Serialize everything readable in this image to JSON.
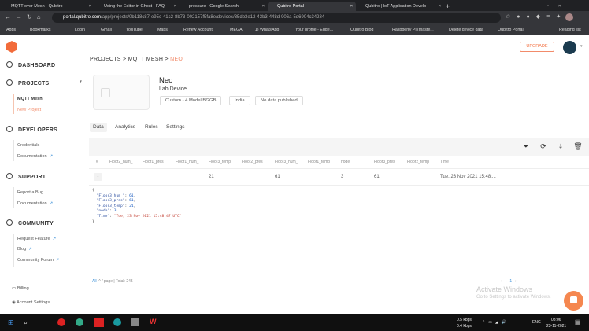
{
  "browser": {
    "tabs": [
      {
        "label": "MQTT over Mesh - Qubitro"
      },
      {
        "label": "Using the Editor in Ghost - FAQ"
      },
      {
        "label": "pressure - Google Search"
      },
      {
        "label": "Qubitro Portal"
      },
      {
        "label": "Qubitro | IoT Application Develo"
      }
    ],
    "url_host": "portal.qubitro.com",
    "url_path": "/app/projects/0b118c87-e95c-41c2-8b73-002157f5fa8e/devices/35db3e12-43b3-448d-906a-5d6904c34284",
    "bookmarks": [
      "Apps",
      "Bookmarks",
      "Login",
      "Gmail",
      "YouTube",
      "Maps",
      "Renew Account",
      "MEGA",
      "(1) WhatsApp",
      "Your profile - Edge...",
      "Qubitro Blog",
      "Raspberry Pi (maste...",
      "Delete device data",
      "Qubitro Portal"
    ],
    "reading_list": "Reading list"
  },
  "sidebar": {
    "dashboard": "DASHBOARD",
    "projects": "PROJECTS",
    "project_items": [
      "MQTT Mesh",
      "New Project"
    ],
    "developers": "DEVELOPERS",
    "developer_items": [
      "Credentials",
      "Documentation"
    ],
    "support": "SUPPORT",
    "support_items": [
      "Report a Bug",
      "Documentation"
    ],
    "community": "COMMUNITY",
    "community_items": [
      "Request Feature",
      "Blog",
      "Community Forum"
    ],
    "billing": "Billing",
    "account": "Account Settings"
  },
  "header": {
    "upgrade": "UPGRADE",
    "breadcrumb": [
      "PROJECTS",
      "MQTT MESH",
      "NEO"
    ]
  },
  "device": {
    "name": "Neo",
    "type": "Lab Device",
    "chips": [
      "Custom - 4 Model B/2GB",
      "India",
      "No data published"
    ]
  },
  "tabs": [
    "Data",
    "Analytics",
    "Rules",
    "Settings"
  ],
  "table": {
    "columns": [
      "#",
      "Floor2_hum_",
      "Floor1_pres",
      "Floor1_hum_",
      "Floor3_temp",
      "Floor2_pres",
      "Floor3_hum_",
      "Floor1_temp",
      "node",
      "Floor3_pres",
      "Floor2_temp",
      "Time"
    ],
    "row": [
      "-",
      "",
      "",
      "",
      "21",
      "",
      "61",
      "",
      "3",
      "61",
      "",
      "Tue, 23 Nov 2021 15:48:..."
    ],
    "json": [
      [
        "\"Floor3_hum_\"",
        "61"
      ],
      [
        "\"Floor3_pres\"",
        "61"
      ],
      [
        "\"Floor3_temp\"",
        "21"
      ],
      [
        "\"node\"",
        "3"
      ]
    ],
    "json_time_key": "\"Time\"",
    "json_time": "\"Tue, 23 Nov 2021 15:48:47 UTC\""
  },
  "pager": {
    "size": "All",
    "per_page": "/ page",
    "total": "Total: 245",
    "page": "1"
  },
  "watermark": {
    "title": "Activate Windows",
    "sub": "Go to Settings to activate Windows."
  },
  "taskbar": {
    "down": "0.5 kbps",
    "up": "0.4 kbps",
    "lang": "ENG",
    "time": "08:06",
    "date": "23-11-2021"
  }
}
